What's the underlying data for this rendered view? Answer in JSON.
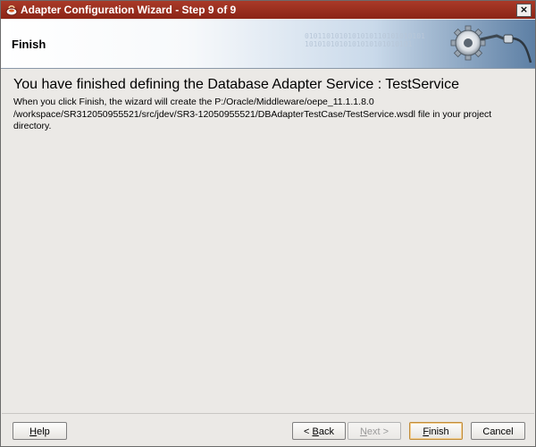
{
  "window": {
    "title": "Adapter Configuration Wizard - Step 9 of 9",
    "close_label": "×"
  },
  "banner": {
    "title": "Finish",
    "binary_lines": [
      "0101101010101010110101010101",
      "1010101010101010101010101"
    ]
  },
  "main": {
    "heading": "You have finished defining the Database Adapter Service : TestService",
    "description_lines": [
      "When you click Finish, the wizard will create the P:/Oracle/Middleware/oepe_11.1.1.8.0",
      "/workspace/SR312050955521/src/jdev/SR3-12050955521/DBAdapterTestCase/TestService.wsdl file in your project",
      "directory."
    ]
  },
  "buttons": {
    "help": {
      "mnemonic": "H",
      "rest": "elp"
    },
    "back": {
      "prefix": "< ",
      "mnemonic": "B",
      "rest": "ack"
    },
    "next": {
      "mnemonic": "N",
      "rest": "ext >"
    },
    "finish": {
      "mnemonic": "F",
      "rest": "inish"
    },
    "cancel": {
      "label": "Cancel"
    }
  },
  "colors": {
    "titlebar": "#962c1c",
    "default_button_border": "#c08c3a"
  }
}
